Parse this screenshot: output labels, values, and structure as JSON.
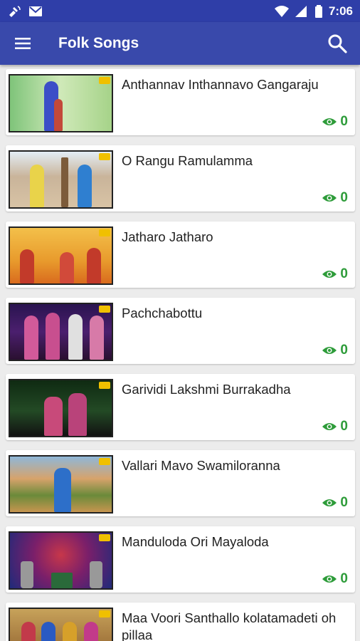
{
  "status_bar": {
    "time": "7:06",
    "icons": [
      "satellite-icon",
      "gmail-icon",
      "wifi-icon",
      "signal-icon",
      "battery-icon"
    ]
  },
  "app_bar": {
    "title": "Folk Songs",
    "menu_icon": "menu-icon",
    "search_icon": "search-icon"
  },
  "colors": {
    "primary": "#3949ab",
    "primary_dark": "#2f3ea8",
    "views_green": "#2e9c3a"
  },
  "songs": [
    {
      "title": "Anthannav Inthannavo Gangaraju",
      "views": "0"
    },
    {
      "title": "O Rangu Ramulamma",
      "views": "0"
    },
    {
      "title": "Jatharo Jatharo",
      "views": "0"
    },
    {
      "title": "Pachchabottu",
      "views": "0"
    },
    {
      "title": "Garividi Lakshmi Burrakadha",
      "views": "0"
    },
    {
      "title": "Vallari Mavo Swamiloranna",
      "views": "0"
    },
    {
      "title": "Manduloda Ori Mayaloda",
      "views": "0"
    },
    {
      "title": "Maa Voori Santhallo kolatamadeti oh pillaa",
      "views": ""
    }
  ]
}
